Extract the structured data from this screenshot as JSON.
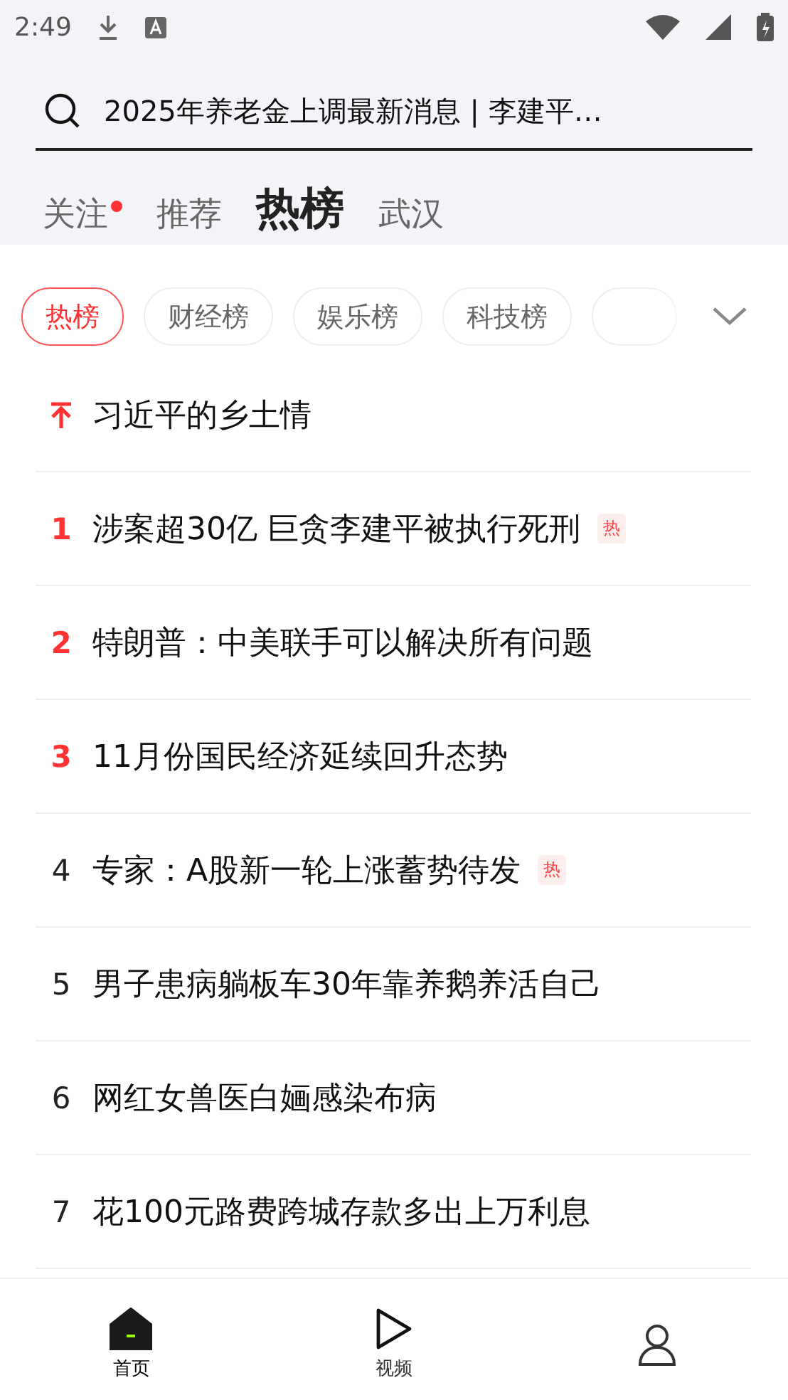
{
  "status_bar": {
    "time": "2:49"
  },
  "search": {
    "value": "2025年养老金上调最新消息 | 李建平…"
  },
  "tabs": [
    {
      "label": "关注",
      "selected": false,
      "dot": true
    },
    {
      "label": "推荐",
      "selected": false,
      "dot": false
    },
    {
      "label": "热榜",
      "selected": true,
      "dot": false
    },
    {
      "label": "武汉",
      "selected": false,
      "dot": false
    }
  ],
  "chips": [
    {
      "label": "热榜",
      "selected": true
    },
    {
      "label": "财经榜",
      "selected": false
    },
    {
      "label": "娱乐榜",
      "selected": false
    },
    {
      "label": "科技榜",
      "selected": false
    }
  ],
  "list": [
    {
      "kind": "pinned",
      "title": "习近平的乡土情",
      "hot": false
    },
    {
      "kind": "ranked",
      "rank": "1",
      "title": "涉案超30亿 巨贪李建平被执行死刑",
      "hot": true,
      "badge": "热",
      "top": true
    },
    {
      "kind": "ranked",
      "rank": "2",
      "title": "特朗普：中美联手可以解决所有问题",
      "hot": false,
      "top": true
    },
    {
      "kind": "ranked",
      "rank": "3",
      "title": "11月份国民经济延续回升态势",
      "hot": false,
      "top": true
    },
    {
      "kind": "ranked",
      "rank": "4",
      "title": "专家：A股新一轮上涨蓄势待发",
      "hot": true,
      "badge": "热",
      "top": false
    },
    {
      "kind": "ranked",
      "rank": "5",
      "title": "男子患病躺板车30年靠养鹅养活自己",
      "hot": false,
      "top": false
    },
    {
      "kind": "ranked",
      "rank": "6",
      "title": "网红女兽医白婳感染布病",
      "hot": false,
      "top": false
    },
    {
      "kind": "ranked",
      "rank": "7",
      "title": "花100元路费跨城存款多出上万利息",
      "hot": false,
      "top": false
    }
  ],
  "nav": [
    {
      "kind": "home",
      "label": "首页",
      "selected": true
    },
    {
      "kind": "video",
      "label": "视频",
      "selected": false
    },
    {
      "kind": "person",
      "selected": false
    }
  ]
}
